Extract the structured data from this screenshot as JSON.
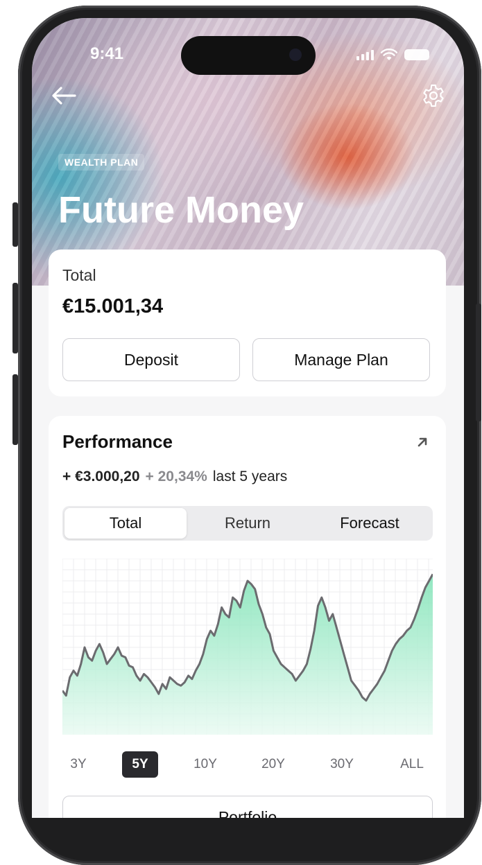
{
  "status_bar": {
    "time": "9:41"
  },
  "header": {
    "badge": "WEALTH PLAN",
    "title": "Future Money",
    "back_icon": "arrow-left-icon",
    "settings_icon": "gear-icon"
  },
  "total_card": {
    "label": "Total",
    "value": "€15.001,34",
    "deposit_label": "Deposit",
    "manage_label": "Manage Plan"
  },
  "performance": {
    "title": "Performance",
    "gain_amount": "+ €3.000,20",
    "gain_percent": "+ 20,34%",
    "period": "last 5 years",
    "tabs": [
      {
        "label": "Total",
        "active": true
      },
      {
        "label": "Return",
        "active": false
      },
      {
        "label": "Forecast",
        "active": false
      }
    ],
    "ranges": [
      {
        "label": "3Y",
        "active": false
      },
      {
        "label": "5Y",
        "active": true
      },
      {
        "label": "10Y",
        "active": false
      },
      {
        "label": "20Y",
        "active": false
      },
      {
        "label": "30Y",
        "active": false
      },
      {
        "label": "ALL",
        "active": false
      }
    ],
    "portfolio_label": "Portfolio"
  },
  "colors": {
    "line": "#6b6b6f",
    "fill_top": "#7fe3b6",
    "fill_bottom": "#e9faf2",
    "active_range": "#2a2a2e"
  },
  "chart_data": {
    "type": "area",
    "ylim": [
      0,
      100
    ],
    "values": [
      24,
      21,
      32,
      36,
      33,
      40,
      50,
      44,
      42,
      48,
      52,
      47,
      40,
      43,
      46,
      50,
      45,
      44,
      39,
      38,
      33,
      30,
      34,
      32,
      29,
      26,
      22,
      28,
      25,
      32,
      30,
      28,
      27,
      29,
      33,
      31,
      36,
      40,
      46,
      55,
      60,
      57,
      64,
      74,
      70,
      68,
      80,
      78,
      74,
      84,
      90,
      88,
      85,
      76,
      70,
      62,
      58,
      48,
      44,
      40,
      38,
      36,
      34,
      30,
      33,
      36,
      40,
      49,
      60,
      75,
      80,
      74,
      66,
      70,
      62,
      54,
      46,
      38,
      30,
      27,
      24,
      20,
      18,
      22,
      25,
      28,
      32,
      36,
      42,
      48,
      52,
      55,
      57,
      60,
      62,
      67,
      73,
      80,
      86,
      90,
      94
    ]
  }
}
